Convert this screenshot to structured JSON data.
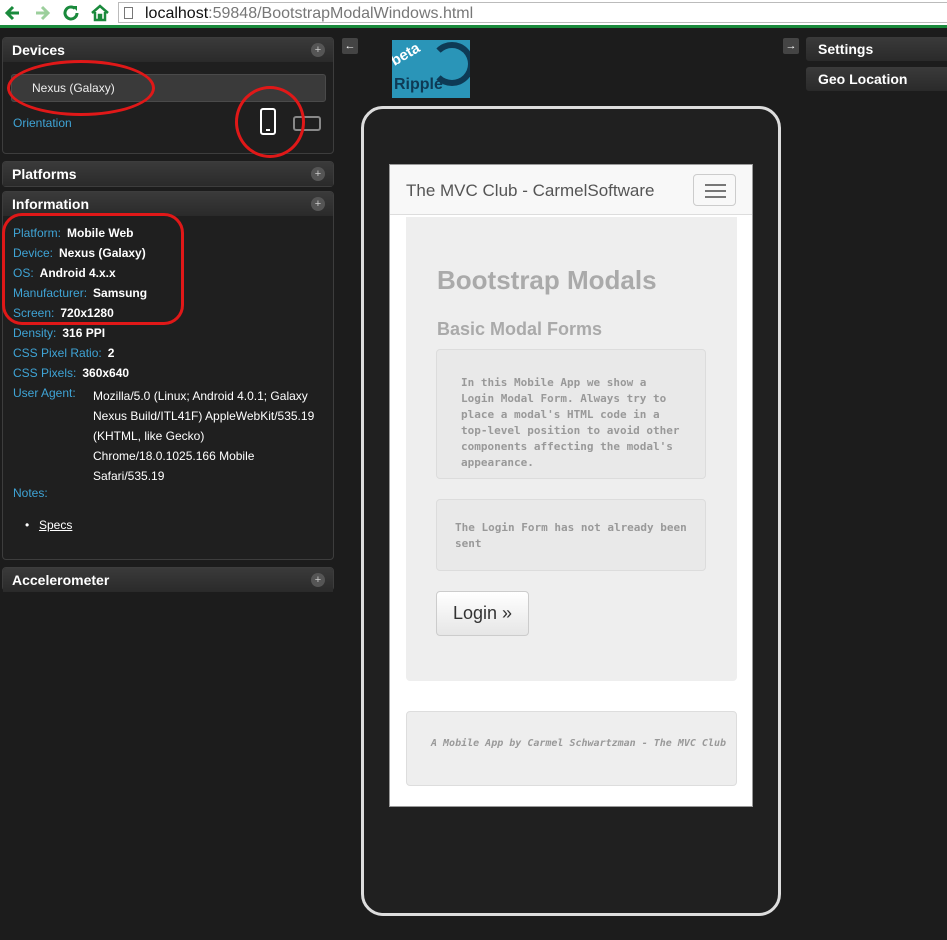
{
  "browser": {
    "url_host": "localhost",
    "url_rest": ":59848/BootstrapModalWindows.html"
  },
  "devices": {
    "title": "Devices",
    "selected": "Nexus (Galaxy)",
    "orientation_label": "Orientation"
  },
  "platforms": {
    "title": "Platforms"
  },
  "information": {
    "title": "Information",
    "rows": [
      {
        "label": "Platform:",
        "value": "Mobile Web"
      },
      {
        "label": "Device:",
        "value": "Nexus (Galaxy)"
      },
      {
        "label": "OS:",
        "value": "Android 4.x.x"
      },
      {
        "label": "Manufacturer:",
        "value": "Samsung"
      },
      {
        "label": "Screen:",
        "value": "720x1280"
      },
      {
        "label": "Density:",
        "value": "316 PPI"
      },
      {
        "label": "CSS Pixel Ratio:",
        "value": "2"
      },
      {
        "label": "CSS Pixels:",
        "value": "360x640"
      }
    ],
    "ua_label": "User Agent:",
    "ua_lines": [
      "Mozilla/5.0 (Linux; Android 4.0.1; Galaxy",
      "Nexus Build/ITL41F) AppleWebKit/535.19",
      "(KHTML, like Gecko)",
      "Chrome/18.0.1025.166 Mobile",
      "Safari/535.19"
    ],
    "notes_label": "Notes:",
    "specs_link": "Specs"
  },
  "accelerometer": {
    "title": "Accelerometer"
  },
  "right_panels": {
    "settings": "Settings",
    "geo": "Geo Location"
  },
  "logo": {
    "beta": "beta",
    "name": "Ripple"
  },
  "app": {
    "brand": "The MVC Club - CarmelSoftware",
    "h1": "Bootstrap Modals",
    "h2": "Basic Modal Forms",
    "well1": "In this Mobile App we show a Login Modal Form. Always try to place a modal's HTML code in a top-level position to avoid other components affecting the modal's appearance.",
    "well2": "The Login Form has not already been sent",
    "login_btn": "Login »",
    "footer": "A Mobile App by Carmel Schwartzman - The MVC Club"
  },
  "colors": {
    "accent": "#3fa4d6",
    "annotation": "#e01818",
    "browser_bar": "#1a8a3c"
  }
}
